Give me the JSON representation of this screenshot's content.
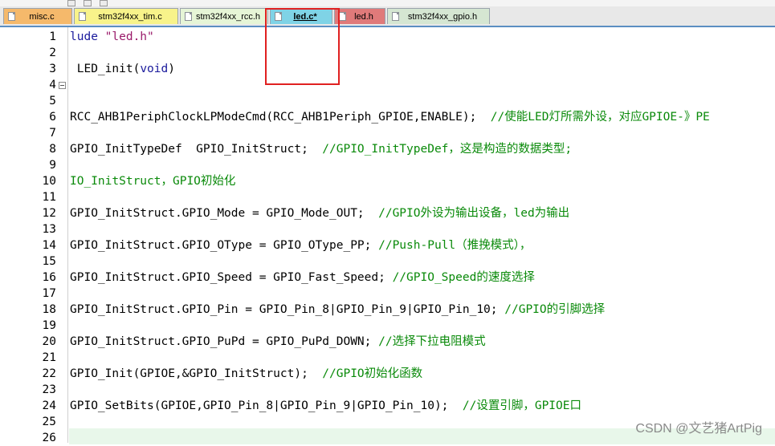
{
  "tabs": [
    {
      "label": "misc.c",
      "color": "#f5b96b",
      "active": false
    },
    {
      "label": "stm32f4xx_tim.c",
      "color": "#f8f38a",
      "active": false
    },
    {
      "label": "stm32f4xx_rcc.h",
      "color": "#e6f5d6",
      "active": false
    },
    {
      "label": "led.c*",
      "color": "#7fd3e6",
      "active": true
    },
    {
      "label": "led.h",
      "color": "#e07a7a",
      "active": false
    },
    {
      "label": "stm32f4xx_gpio.h",
      "color": "#d5e6d2",
      "active": false
    }
  ],
  "editor": {
    "line_numbers": [
      "1",
      "2",
      "3",
      "4",
      "5",
      "6",
      "7",
      "8",
      "9",
      "10",
      "11",
      "12",
      "13",
      "14",
      "15",
      "16",
      "17",
      "18",
      "19",
      "20",
      "21",
      "22",
      "23",
      "24",
      "25",
      "26"
    ],
    "lines": [
      {
        "n": "1",
        "parts": [
          {
            "t": "lude ",
            "c": "kw"
          },
          {
            "t": "\"led.h\"",
            "c": "str"
          }
        ]
      },
      {
        "n": "2",
        "parts": []
      },
      {
        "n": "3",
        "parts": [
          {
            "t": " LED_init(",
            "c": ""
          },
          {
            "t": "void",
            "c": "kw"
          },
          {
            "t": ")",
            "c": ""
          }
        ]
      },
      {
        "n": "4",
        "parts": []
      },
      {
        "n": "5",
        "parts": []
      },
      {
        "n": "6",
        "parts": [
          {
            "t": "RCC_AHB1PeriphClockLPModeCmd(RCC_AHB1Periph_GPIOE,ENABLE);  ",
            "c": ""
          },
          {
            "t": "//使能LED灯所需外设，对应GPIOE-》PE",
            "c": "cmt"
          }
        ]
      },
      {
        "n": "7",
        "parts": []
      },
      {
        "n": "8",
        "parts": [
          {
            "t": "GPIO_InitTypeDef  GPIO_InitStruct;  ",
            "c": ""
          },
          {
            "t": "//GPIO_InitTypeDef，这是构造的数据类型;",
            "c": "cmt"
          }
        ]
      },
      {
        "n": "9",
        "parts": []
      },
      {
        "n": "10",
        "parts": [
          {
            "t": "IO_InitStruct，GPIO初始化",
            "c": "cmt"
          }
        ]
      },
      {
        "n": "11",
        "parts": []
      },
      {
        "n": "12",
        "parts": [
          {
            "t": "GPIO_InitStruct.GPIO_Mode = GPIO_Mode_OUT;  ",
            "c": ""
          },
          {
            "t": "//GPIO外设为输出设备，led为输出",
            "c": "cmt"
          }
        ]
      },
      {
        "n": "13",
        "parts": []
      },
      {
        "n": "14",
        "parts": [
          {
            "t": "GPIO_InitStruct.GPIO_OType = GPIO_OType_PP; ",
            "c": ""
          },
          {
            "t": "//Push-Pull（推挽模式），",
            "c": "cmt"
          }
        ]
      },
      {
        "n": "15",
        "parts": []
      },
      {
        "n": "16",
        "parts": [
          {
            "t": "GPIO_InitStruct.GPIO_Speed = GPIO_Fast_Speed; ",
            "c": ""
          },
          {
            "t": "//GPIO_Speed的速度选择",
            "c": "cmt"
          }
        ]
      },
      {
        "n": "17",
        "parts": []
      },
      {
        "n": "18",
        "parts": [
          {
            "t": "GPIO_InitStruct.GPIO_Pin = GPIO_Pin_8|GPIO_Pin_9|GPIO_Pin_10; ",
            "c": ""
          },
          {
            "t": "//GPIO的引脚选择",
            "c": "cmt"
          }
        ]
      },
      {
        "n": "19",
        "parts": []
      },
      {
        "n": "20",
        "parts": [
          {
            "t": "GPIO_InitStruct.GPIO_PuPd = GPIO_PuPd_DOWN; ",
            "c": ""
          },
          {
            "t": "//选择下拉电阻模式",
            "c": "cmt"
          }
        ]
      },
      {
        "n": "21",
        "parts": []
      },
      {
        "n": "22",
        "parts": [
          {
            "t": "GPIO_Init(GPIOE,&GPIO_InitStruct);  ",
            "c": ""
          },
          {
            "t": "//GPIO初始化函数",
            "c": "cmt"
          }
        ]
      },
      {
        "n": "23",
        "parts": []
      },
      {
        "n": "24",
        "parts": [
          {
            "t": "GPIO_SetBits(GPIOE,GPIO_Pin_8|GPIO_Pin_9|GPIO_Pin_10);  ",
            "c": ""
          },
          {
            "t": "//设置引脚，GPIOE口",
            "c": "cmt"
          }
        ]
      },
      {
        "n": "25",
        "parts": []
      },
      {
        "n": "26",
        "parts": []
      }
    ]
  },
  "watermark": "CSDN @文艺猪ArtPig",
  "colors": {
    "keyword": "#1a1a9c",
    "string": "#9a1a6a",
    "comment": "#0a8a0a",
    "highlight_box": "#e02020",
    "current_line": "#e8f7ea"
  }
}
